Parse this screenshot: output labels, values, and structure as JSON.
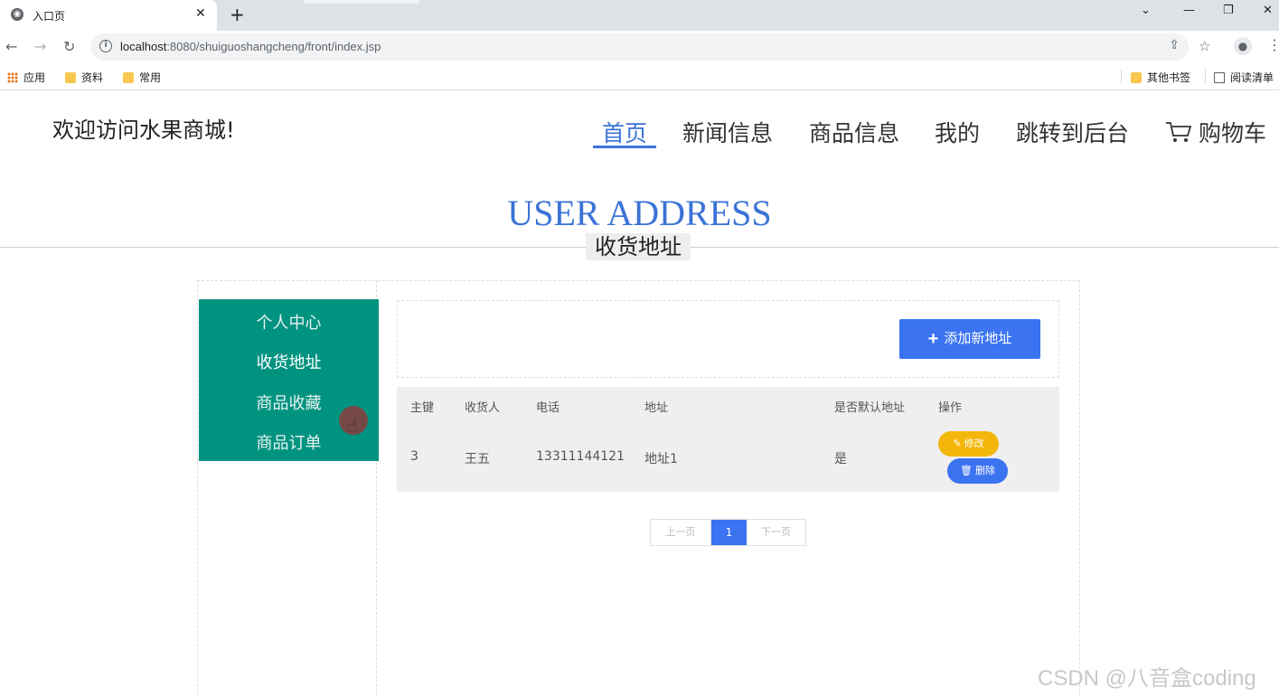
{
  "browser": {
    "tab_title": "入口页",
    "url_host": "localhost",
    "url_rest": ":8080/shuiguoshangcheng/front/index.jsp",
    "bookmarks": [
      "应用",
      "资料",
      "常用"
    ],
    "bookmarks_right": [
      "其他书签",
      "阅读清单"
    ]
  },
  "site": {
    "title": "欢迎访问水果商城!",
    "nav": [
      "首页",
      "新闻信息",
      "商品信息",
      "我的",
      "跳转到后台"
    ],
    "cart_label": "购物车"
  },
  "section": {
    "title_en": "USER ADDRESS",
    "title_cn": "收货地址"
  },
  "sidebar": {
    "items": [
      "个人中心",
      "收货地址",
      "商品收藏",
      "商品订单"
    ]
  },
  "main": {
    "add_button": "添加新地址",
    "table": {
      "headers": [
        "主键",
        "收货人",
        "电话",
        "地址",
        "是否默认地址",
        "操作"
      ],
      "rows": [
        {
          "id": "3",
          "name": "王五",
          "phone": "13311144121",
          "address": "地址1",
          "is_default": "是"
        }
      ],
      "edit_label": "修改",
      "delete_label": "删除"
    },
    "pagination": {
      "prev": "上一页",
      "current": "1",
      "next": "下一页"
    }
  },
  "watermark": "CSDN @八音盒coding",
  "colors": {
    "accent": "#3b73d6",
    "sidebar": "#009380",
    "edit": "#f3b70c",
    "button": "#3b73f0"
  }
}
